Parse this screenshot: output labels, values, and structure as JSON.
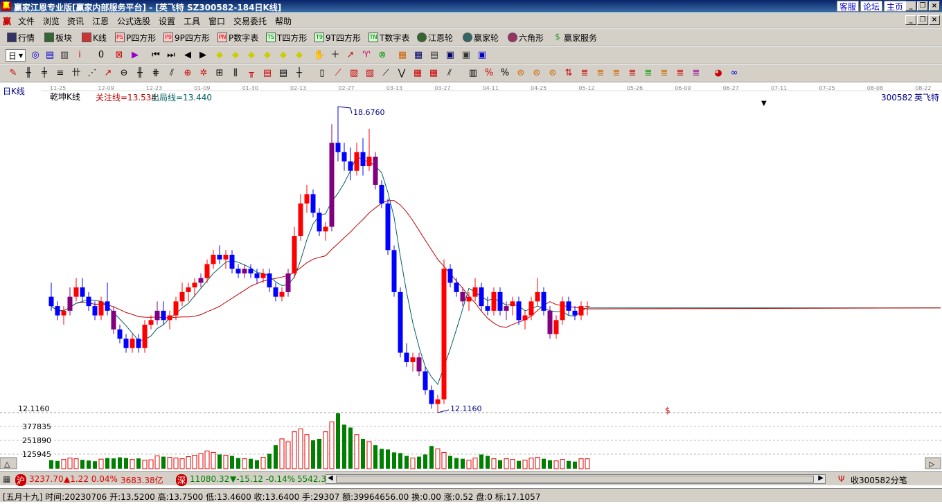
{
  "window": {
    "title": "赢家江恩专业版[赢家内部服务平台] - [英飞特   SZ300582-184日K线]",
    "logo": "赢",
    "top_links": [
      "客服",
      "论坛",
      "主页"
    ]
  },
  "menu": [
    "文件",
    "浏览",
    "资讯",
    "江恩",
    "公式选股",
    "设置",
    "工具",
    "窗口",
    "交易委托",
    "帮助"
  ],
  "menu_logo": "赢",
  "toolbar1": [
    {
      "label": "行情",
      "icon": "grid-icon"
    },
    {
      "label": "板块",
      "icon": "blocks-icon"
    },
    {
      "label": "K线",
      "icon": "candles-icon"
    },
    {
      "label": "P四方形",
      "icon": "p-square-icon",
      "tag": "PS"
    },
    {
      "label": "9P四方形",
      "icon": "9p-square-icon",
      "tag": "P9"
    },
    {
      "label": "P数字表",
      "icon": "p-table-icon",
      "tag": "PN"
    },
    {
      "label": "T四方形",
      "icon": "t-square-icon",
      "tag": "TS"
    },
    {
      "label": "9T四方形",
      "icon": "9t-square-icon",
      "tag": "T9"
    },
    {
      "label": "T数字表",
      "icon": "t-table-icon",
      "tag": "TN"
    },
    {
      "label": "江恩轮",
      "icon": "gann-wheel-icon"
    },
    {
      "label": "赢家轮",
      "icon": "winner-wheel-icon"
    },
    {
      "label": "六角形",
      "icon": "hexagon-icon"
    },
    {
      "label": "赢家服务",
      "icon": "dollar-icon"
    }
  ],
  "period_select": "日",
  "chart_header": {
    "period_label": "日K线",
    "indicator_name": "乾坤K线",
    "focus_line": "关注线=13.534",
    "exit_line": "出局线=13.440",
    "stock_code": "300582",
    "stock_name": "英飞特",
    "high_mark": "18.6760",
    "low_mark": "12.1160",
    "low_axis": "12.1160",
    "vol_ticks": [
      "377835",
      "251890",
      "125945"
    ]
  },
  "date_axis": [
    "11-25",
    "12-09",
    "12-23",
    "01-09",
    "01-30",
    "02-13",
    "02-27",
    "03-13",
    "03-27",
    "04-11",
    "04-25",
    "05-12",
    "05-26",
    "06-09",
    "06-27",
    "07-11",
    "07-25",
    "08-08",
    "08-22"
  ],
  "status": {
    "sh_tag": "沪",
    "sh_index": "3237.70",
    "sh_change": "▲1.22 0.04%",
    "sh_amount": "3683.38亿",
    "sz_tag": "深",
    "sz_index": "11080.32",
    "sz_change": "▼-15.12 -0.14%",
    "sz_amount": "5542.3",
    "tick_label": "收300582分笔"
  },
  "info": "[五月十九] 时间:20230706 开:13.5200 高:13.7500 低:13.4600 收:13.6400 手:29307 额:39964656.00 换:0.00 涨:0.52 盘:0 标:17.1057",
  "colors": {
    "up": "#ff0000",
    "down": "#0000ff",
    "neutral": "#800080",
    "accent": "#0a246a"
  },
  "chart_data": {
    "type": "candlestick",
    "price_range": [
      12.116,
      18.676
    ],
    "candles": [
      {
        "o": 14.6,
        "h": 14.9,
        "l": 14.3,
        "c": 14.4
      },
      {
        "o": 14.4,
        "h": 14.5,
        "l": 14.1,
        "c": 14.2
      },
      {
        "o": 14.2,
        "h": 14.4,
        "l": 14.0,
        "c": 14.3
      },
      {
        "o": 14.3,
        "h": 14.8,
        "l": 14.2,
        "c": 14.6
      },
      {
        "o": 14.6,
        "h": 15.0,
        "l": 14.5,
        "c": 14.8
      },
      {
        "o": 14.8,
        "h": 15.0,
        "l": 14.5,
        "c": 14.6
      },
      {
        "o": 14.6,
        "h": 14.7,
        "l": 14.3,
        "c": 14.4
      },
      {
        "o": 14.4,
        "h": 14.5,
        "l": 14.1,
        "c": 14.2
      },
      {
        "o": 14.2,
        "h": 14.6,
        "l": 14.1,
        "c": 14.5
      },
      {
        "o": 14.5,
        "h": 14.9,
        "l": 14.2,
        "c": 14.3
      },
      {
        "o": 14.3,
        "h": 14.4,
        "l": 13.8,
        "c": 13.9
      },
      {
        "o": 13.9,
        "h": 14.0,
        "l": 13.6,
        "c": 13.7
      },
      {
        "o": 13.7,
        "h": 13.8,
        "l": 13.4,
        "c": 13.5
      },
      {
        "o": 13.5,
        "h": 13.8,
        "l": 13.4,
        "c": 13.7
      },
      {
        "o": 13.7,
        "h": 13.8,
        "l": 13.4,
        "c": 13.5
      },
      {
        "o": 13.5,
        "h": 14.1,
        "l": 13.4,
        "c": 14.0
      },
      {
        "o": 14.0,
        "h": 14.2,
        "l": 13.9,
        "c": 14.1
      },
      {
        "o": 14.1,
        "h": 14.5,
        "l": 14.0,
        "c": 14.3
      },
      {
        "o": 14.3,
        "h": 14.5,
        "l": 14.0,
        "c": 14.1
      },
      {
        "o": 14.1,
        "h": 14.3,
        "l": 13.9,
        "c": 14.2
      },
      {
        "o": 14.2,
        "h": 14.6,
        "l": 14.1,
        "c": 14.5
      },
      {
        "o": 14.5,
        "h": 14.9,
        "l": 14.4,
        "c": 14.7
      },
      {
        "o": 14.7,
        "h": 14.9,
        "l": 14.5,
        "c": 14.8
      },
      {
        "o": 14.8,
        "h": 15.0,
        "l": 14.6,
        "c": 14.9
      },
      {
        "o": 14.9,
        "h": 15.1,
        "l": 14.8,
        "c": 15.0
      },
      {
        "o": 15.0,
        "h": 15.4,
        "l": 14.9,
        "c": 15.3
      },
      {
        "o": 15.3,
        "h": 15.6,
        "l": 15.2,
        "c": 15.5
      },
      {
        "o": 15.5,
        "h": 15.7,
        "l": 15.3,
        "c": 15.4
      },
      {
        "o": 15.4,
        "h": 15.6,
        "l": 15.2,
        "c": 15.5
      },
      {
        "o": 15.5,
        "h": 15.6,
        "l": 15.1,
        "c": 15.2
      },
      {
        "o": 15.2,
        "h": 15.3,
        "l": 15.0,
        "c": 15.1
      },
      {
        "o": 15.1,
        "h": 15.3,
        "l": 15.0,
        "c": 15.2
      },
      {
        "o": 15.2,
        "h": 15.3,
        "l": 15.0,
        "c": 15.1
      },
      {
        "o": 15.1,
        "h": 15.2,
        "l": 14.9,
        "c": 15.0
      },
      {
        "o": 15.0,
        "h": 15.2,
        "l": 14.9,
        "c": 15.1
      },
      {
        "o": 15.1,
        "h": 15.2,
        "l": 14.7,
        "c": 14.8
      },
      {
        "o": 14.8,
        "h": 14.9,
        "l": 14.5,
        "c": 14.6
      },
      {
        "o": 14.6,
        "h": 14.8,
        "l": 14.5,
        "c": 14.7
      },
      {
        "o": 14.7,
        "h": 15.2,
        "l": 14.6,
        "c": 15.1
      },
      {
        "o": 15.1,
        "h": 16.1,
        "l": 15.0,
        "c": 15.9
      },
      {
        "o": 15.9,
        "h": 16.8,
        "l": 15.8,
        "c": 16.6
      },
      {
        "o": 16.6,
        "h": 17.0,
        "l": 16.4,
        "c": 16.8
      },
      {
        "o": 16.8,
        "h": 16.9,
        "l": 16.3,
        "c": 16.4
      },
      {
        "o": 16.4,
        "h": 16.5,
        "l": 15.9,
        "c": 16.0
      },
      {
        "o": 16.0,
        "h": 16.2,
        "l": 15.8,
        "c": 16.1
      },
      {
        "o": 16.1,
        "h": 18.3,
        "l": 16.0,
        "c": 17.9
      },
      {
        "o": 17.9,
        "h": 18.676,
        "l": 17.5,
        "c": 17.7
      },
      {
        "o": 17.7,
        "h": 17.9,
        "l": 17.3,
        "c": 17.5
      },
      {
        "o": 17.5,
        "h": 17.8,
        "l": 17.1,
        "c": 17.3
      },
      {
        "o": 17.3,
        "h": 17.9,
        "l": 17.2,
        "c": 17.7
      },
      {
        "o": 17.7,
        "h": 18.0,
        "l": 17.2,
        "c": 17.4
      },
      {
        "o": 17.4,
        "h": 18.2,
        "l": 17.3,
        "c": 17.6
      },
      {
        "o": 17.6,
        "h": 17.7,
        "l": 16.9,
        "c": 17.0
      },
      {
        "o": 17.0,
        "h": 17.1,
        "l": 16.5,
        "c": 16.6
      },
      {
        "o": 16.6,
        "h": 16.7,
        "l": 15.5,
        "c": 15.6
      },
      {
        "o": 15.6,
        "h": 15.7,
        "l": 14.6,
        "c": 14.7
      },
      {
        "o": 14.7,
        "h": 14.8,
        "l": 13.3,
        "c": 13.4
      },
      {
        "o": 13.4,
        "h": 13.6,
        "l": 13.1,
        "c": 13.2
      },
      {
        "o": 13.2,
        "h": 13.4,
        "l": 13.0,
        "c": 13.3
      },
      {
        "o": 13.3,
        "h": 13.4,
        "l": 12.9,
        "c": 13.0
      },
      {
        "o": 13.0,
        "h": 13.1,
        "l": 12.5,
        "c": 12.6
      },
      {
        "o": 12.6,
        "h": 12.7,
        "l": 12.2,
        "c": 12.3
      },
      {
        "o": 12.3,
        "h": 12.5,
        "l": 12.116,
        "c": 12.4
      },
      {
        "o": 12.4,
        "h": 15.4,
        "l": 12.3,
        "c": 15.2
      },
      {
        "o": 15.2,
        "h": 15.3,
        "l": 14.8,
        "c": 14.9
      },
      {
        "o": 14.9,
        "h": 15.0,
        "l": 14.6,
        "c": 14.7
      },
      {
        "o": 14.7,
        "h": 14.8,
        "l": 14.4,
        "c": 14.5
      },
      {
        "o": 14.5,
        "h": 14.7,
        "l": 14.3,
        "c": 14.6
      },
      {
        "o": 14.6,
        "h": 15.0,
        "l": 14.5,
        "c": 14.8
      },
      {
        "o": 14.8,
        "h": 14.9,
        "l": 14.3,
        "c": 14.4
      },
      {
        "o": 14.4,
        "h": 14.6,
        "l": 14.2,
        "c": 14.3
      },
      {
        "o": 14.3,
        "h": 14.8,
        "l": 14.2,
        "c": 14.7
      },
      {
        "o": 14.7,
        "h": 14.8,
        "l": 14.2,
        "c": 14.3
      },
      {
        "o": 14.3,
        "h": 14.5,
        "l": 14.1,
        "c": 14.4
      },
      {
        "o": 14.4,
        "h": 14.6,
        "l": 14.2,
        "c": 14.5
      },
      {
        "o": 14.5,
        "h": 14.6,
        "l": 14.0,
        "c": 14.1
      },
      {
        "o": 14.1,
        "h": 14.3,
        "l": 13.9,
        "c": 14.2
      },
      {
        "o": 14.2,
        "h": 14.6,
        "l": 14.1,
        "c": 14.5
      },
      {
        "o": 14.5,
        "h": 15.0,
        "l": 14.4,
        "c": 14.7
      },
      {
        "o": 14.7,
        "h": 14.8,
        "l": 14.2,
        "c": 14.3
      },
      {
        "o": 14.3,
        "h": 14.4,
        "l": 13.7,
        "c": 13.8
      },
      {
        "o": 13.8,
        "h": 14.2,
        "l": 13.7,
        "c": 14.1
      },
      {
        "o": 14.1,
        "h": 14.6,
        "l": 14.0,
        "c": 14.5
      },
      {
        "o": 14.5,
        "h": 14.6,
        "l": 14.2,
        "c": 14.3
      },
      {
        "o": 14.3,
        "h": 14.4,
        "l": 14.1,
        "c": 14.2
      },
      {
        "o": 14.2,
        "h": 14.5,
        "l": 14.1,
        "c": 14.4
      },
      {
        "o": 14.4,
        "h": 14.5,
        "l": 14.2,
        "c": 14.4
      }
    ],
    "ma_focus_series": "fast",
    "ma_exit_series": "slow",
    "volume": [
      120,
      110,
      130,
      150,
      140,
      125,
      115,
      105,
      135,
      150,
      145,
      160,
      150,
      130,
      145,
      120,
      125,
      180,
      170,
      160,
      150,
      140,
      170,
      190,
      210,
      250,
      230,
      200,
      190,
      180,
      150,
      140,
      140,
      120,
      160,
      210,
      330,
      420,
      380,
      520,
      560,
      480,
      400,
      420,
      520,
      660,
      780,
      620,
      580,
      480,
      420,
      380,
      330,
      280,
      270,
      230,
      220,
      180,
      150,
      170,
      200,
      320,
      280,
      230,
      180,
      150,
      140,
      120,
      150,
      200,
      180,
      140,
      120,
      140,
      130,
      110,
      120,
      150,
      160,
      140,
      120,
      110,
      130,
      110,
      100,
      140,
      140
    ]
  }
}
